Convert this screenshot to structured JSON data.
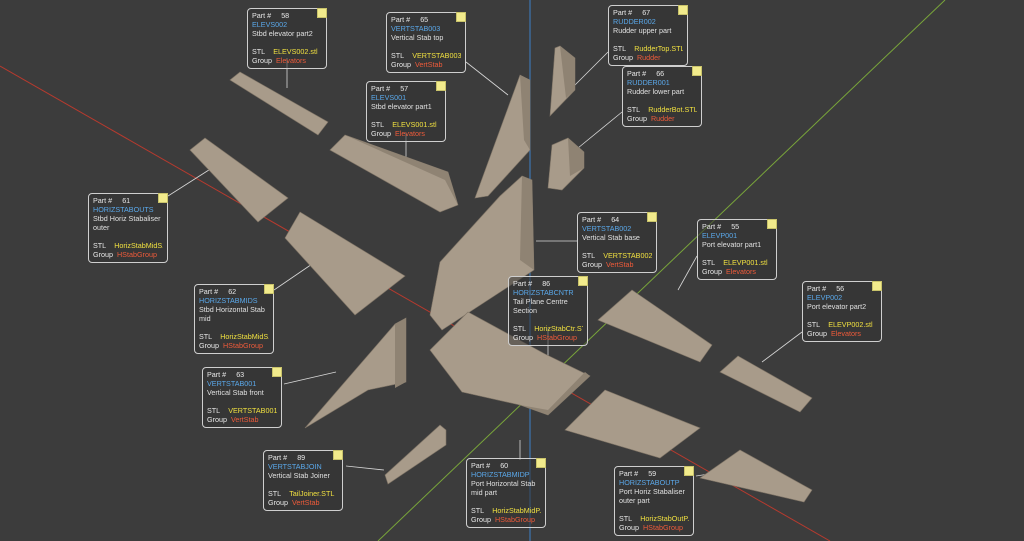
{
  "app": {
    "field_part": "Part #",
    "field_stl": "STL",
    "field_group": "Group"
  },
  "colors": {
    "background": "#3c3c3c",
    "part_fill": "#a89b8a",
    "part_shade": "#8f8373",
    "axis_x": "#c0392b",
    "axis_y": "#7fae3a",
    "axis_z": "#3d7fc8",
    "name": "#5aa8ea",
    "stl": "#f0e040",
    "group": "#ef5b3a"
  },
  "labels": [
    {
      "id": "58",
      "part_no": "58",
      "name": "ELEVS002",
      "desc": "Stbd elevator part2",
      "stl": "ELEVS002.stl",
      "group": "Elevators"
    },
    {
      "id": "65",
      "part_no": "65",
      "name": "VERTSTAB003",
      "desc": "Vertical Stab top",
      "stl": "VERTSTAB003.STL",
      "group": "VertStab"
    },
    {
      "id": "67",
      "part_no": "67",
      "name": "RUDDER002",
      "desc": "Rudder upper part",
      "stl": "RudderTop.STL",
      "group": "Rudder"
    },
    {
      "id": "66",
      "part_no": "66",
      "name": "RUDDER001",
      "desc": "Rudder lower part",
      "stl": "RudderBot.STL",
      "group": "Rudder"
    },
    {
      "id": "57",
      "part_no": "57",
      "name": "ELEVS001",
      "desc": "Stbd elevator part1",
      "stl": "ELEVS001.stl",
      "group": "Elevators"
    },
    {
      "id": "61",
      "part_no": "61",
      "name": "HORIZSTABOUTS",
      "desc": "Stbd Horiz Stabaliser outer",
      "stl": "HorizStabMidS.stl",
      "group": "HStabGroup"
    },
    {
      "id": "64",
      "part_no": "64",
      "name": "VERTSTAB002",
      "desc": "Vertical Stab base",
      "stl": "VERTSTAB002.STL",
      "group": "VertStab"
    },
    {
      "id": "55",
      "part_no": "55",
      "name": "ELEVP001",
      "desc": "Port elevator part1",
      "stl": "ELEVP001.stl",
      "group": "Elevators"
    },
    {
      "id": "86",
      "part_no": "86",
      "name": "HORIZSTABCNTR",
      "desc": "Tail Plane Centre Section",
      "stl": "HorizStabCtr.STL",
      "group": "HStabGroup"
    },
    {
      "id": "56",
      "part_no": "56",
      "name": "ELEVP002",
      "desc": "Port elevator part2",
      "stl": "ELEVP002.stl",
      "group": "Elevators"
    },
    {
      "id": "62",
      "part_no": "62",
      "name": "HORIZSTABMIDS",
      "desc": "Stbd Horizontal Stab mid",
      "stl": "HorizStabMidS.stl",
      "group": "HStabGroup"
    },
    {
      "id": "63",
      "part_no": "63",
      "name": "VERTSTAB001",
      "desc": "Vertical Stab front",
      "stl": "VERTSTAB001.STL",
      "group": "VertStab"
    },
    {
      "id": "89",
      "part_no": "89",
      "name": "VERTSTABJOIN",
      "desc": "Vertical Stab Joiner",
      "stl": "TailJoiner.STL",
      "group": "VertStab"
    },
    {
      "id": "60",
      "part_no": "60",
      "name": "HORIZSTABMIDP",
      "desc": "Port Horizontal Stab mid part",
      "stl": "HorizStabMidP.stl",
      "group": "HStabGroup"
    },
    {
      "id": "59",
      "part_no": "59",
      "name": "HORIZSTABOUTP",
      "desc": "Port Horiz Stabaliser outer part",
      "stl": "HorizStabOutP.stl",
      "group": "HStabGroup"
    }
  ]
}
